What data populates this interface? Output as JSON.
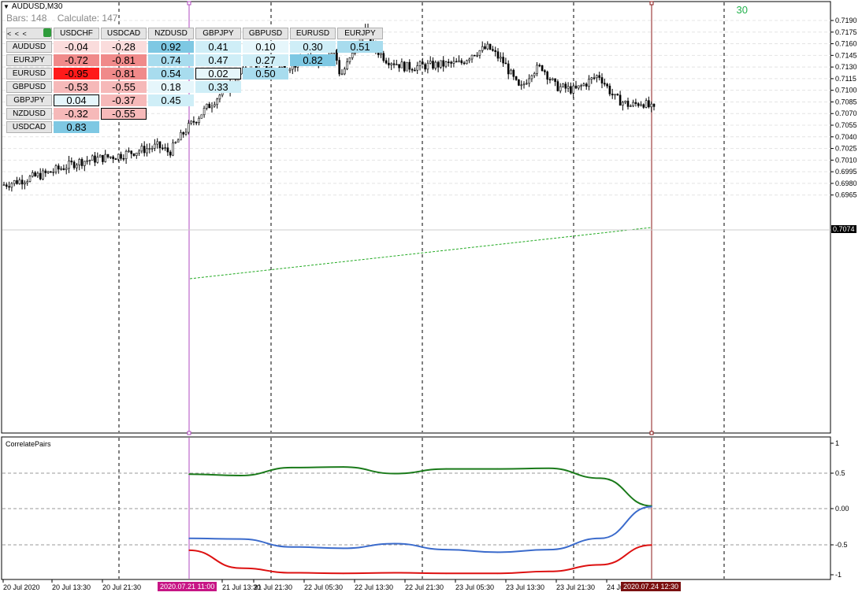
{
  "window": {
    "title": "AUDUSD,M30",
    "bars_label": "Bars: 148",
    "calc_label": "Calculate: 147",
    "count_badge": "30"
  },
  "matrix": {
    "nav_label": "< < <",
    "columns": [
      "USDCHF",
      "USDCAD",
      "NZDUSD",
      "GBPJPY",
      "GBPUSD",
      "EURUSD",
      "EURJPY"
    ],
    "rows": [
      {
        "label": "AUDUSD",
        "cells": [
          "-0.04",
          "-0.28",
          "0.92",
          "0.41",
          "0.10",
          "0.30",
          "0.51"
        ]
      },
      {
        "label": "EURJPY",
        "cells": [
          "-0.72",
          "-0.81",
          "0.74",
          "0.47",
          "0.27",
          "0.82"
        ]
      },
      {
        "label": "EURUSD",
        "cells": [
          "-0.95",
          "-0.81",
          "0.54",
          "0.02",
          "0.50"
        ]
      },
      {
        "label": "GBPUSD",
        "cells": [
          "-0.53",
          "-0.55",
          "0.18",
          "0.33"
        ]
      },
      {
        "label": "GBPJPY",
        "cells": [
          "0.04",
          "-0.37",
          "0.45"
        ]
      },
      {
        "label": "NZDUSD",
        "cells": [
          "-0.32",
          "-0.55"
        ]
      },
      {
        "label": "USDCAD",
        "cells": [
          "0.83"
        ]
      }
    ],
    "colors": {
      "pos_strong": "#7ec8e3",
      "pos_mid": "#a8dcee",
      "pos_light": "#cfeef7",
      "pos_faint": "#e6f6fb",
      "neg_strong": "#ff1a1a",
      "neg_mid": "#f08a8a",
      "neg_light": "#f6b9b9",
      "neg_faint": "#fadcdc"
    }
  },
  "price_axis": {
    "labels": [
      "0.7190",
      "0.7175",
      "0.7160",
      "0.7145",
      "0.7130",
      "0.7115",
      "0.7100",
      "0.7085",
      "0.7070",
      "0.7055",
      "0.7040",
      "0.7025",
      "0.7010",
      "0.6995",
      "0.6980",
      "0.6965"
    ],
    "current_price": "0.7074"
  },
  "indicator": {
    "name": "CorrelatePairs",
    "axis_labels": [
      "1",
      "0.5",
      "0.00",
      "-0.5",
      "-1"
    ]
  },
  "time_axis": {
    "labels": [
      "20 Jul 2020",
      "20 Jul 13:30",
      "20 Jul 21:30",
      "21 Jul 13:30",
      "21 Jul 21:30",
      "22 Jul 05:30",
      "22 Jul 13:30",
      "22 Jul 21:30",
      "23 Jul 05:30",
      "23 Jul 13:30",
      "23 Jul 21:30",
      "24 Jul"
    ],
    "highlight_start": "2020.07.21 11:00",
    "highlight_end": "2020.07.24 12:30"
  },
  "chart_data": {
    "type": "line",
    "title": "CorrelatePairs",
    "ylim": [
      -1,
      1
    ],
    "x": [
      "2020.07.21 11:00",
      "21 Jul 13:30",
      "21 Jul 21:30",
      "22 Jul 05:30",
      "22 Jul 13:30",
      "22 Jul 21:30",
      "23 Jul 05:30",
      "23 Jul 13:30",
      "23 Jul 21:30",
      "2020.07.24 12:30"
    ],
    "series": [
      {
        "color": "#1a7a1a",
        "values": [
          0.52,
          0.5,
          0.62,
          0.63,
          0.53,
          0.6,
          0.6,
          0.61,
          0.46,
          0.04
        ]
      },
      {
        "color": "#3b6bcc",
        "values": [
          -0.45,
          -0.46,
          -0.58,
          -0.6,
          -0.53,
          -0.62,
          -0.66,
          -0.62,
          -0.45,
          0.03
        ]
      },
      {
        "color": "#dd1111",
        "values": [
          -0.63,
          -0.9,
          -0.97,
          -0.98,
          -0.97,
          -0.98,
          -0.98,
          -0.95,
          -0.85,
          -0.55
        ]
      }
    ]
  }
}
